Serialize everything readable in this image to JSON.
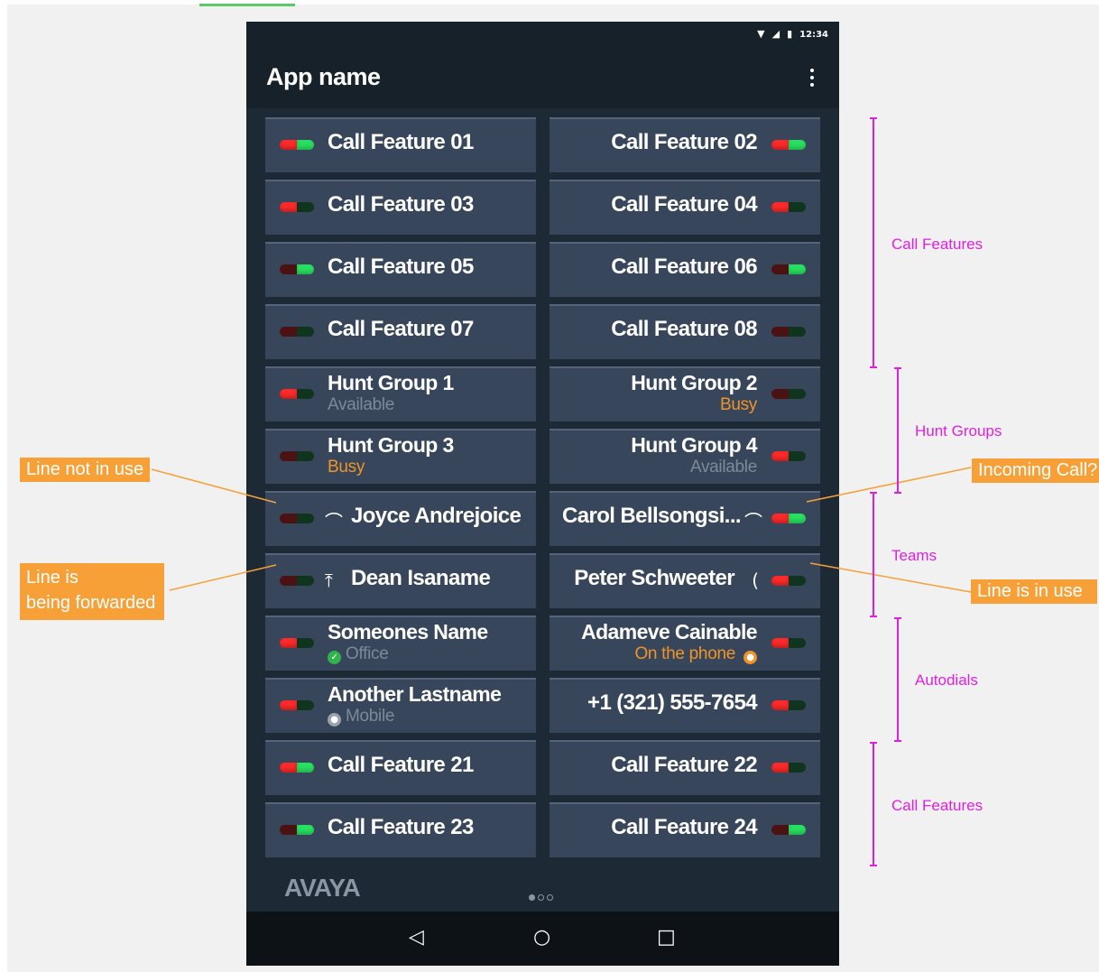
{
  "statusbar": {
    "time": "12:34"
  },
  "app": {
    "title": "App name",
    "brand": "AVAYA"
  },
  "tiles": [
    {
      "label": "Call Feature 01"
    },
    {
      "label": "Call Feature 02"
    },
    {
      "label": "Call Feature 03"
    },
    {
      "label": "Call Feature 04"
    },
    {
      "label": "Call Feature 05"
    },
    {
      "label": "Call Feature 06"
    },
    {
      "label": "Call Feature 07"
    },
    {
      "label": "Call Feature 08"
    },
    {
      "label": "Hunt Group 1",
      "sub": "Available"
    },
    {
      "label": "Hunt Group 2",
      "sub": "Busy"
    },
    {
      "label": "Hunt Group 3",
      "sub": "Busy"
    },
    {
      "label": "Hunt Group 4",
      "sub": "Available"
    },
    {
      "label": "Joyce Andrejoice"
    },
    {
      "label": "Carol Bellsongsi..."
    },
    {
      "label": "Dean Isaname"
    },
    {
      "label": "Peter Schweeter"
    },
    {
      "label": "Someones Name",
      "sub": "Office"
    },
    {
      "label": "Adameve Cainable",
      "sub": "On the phone"
    },
    {
      "label": "Another Lastname",
      "sub": "Mobile"
    },
    {
      "label": "+1 (321) 555-7654"
    },
    {
      "label": "Call Feature 21"
    },
    {
      "label": "Call Feature 22"
    },
    {
      "label": "Call Feature 23"
    },
    {
      "label": "Call Feature 24"
    }
  ],
  "annotations": {
    "callouts": {
      "line_not_in_use": "Line not in use",
      "forwarded_1": "Line is",
      "forwarded_2": "being forwarded",
      "incoming": "Incoming Call?",
      "in_use": "Line is  in use"
    },
    "brackets": {
      "call_features_top": "Call Features",
      "hunt_groups": "Hunt Groups",
      "teams": "Teams",
      "autodials": "Autodials",
      "call_features_bottom": "Call Features"
    }
  },
  "colors": {
    "accent_orange": "#f7a038",
    "bracket_magenta": "#e020e0",
    "tile_bg": "#37465a",
    "led_red": "#ff2a2a",
    "led_green": "#28e060"
  }
}
